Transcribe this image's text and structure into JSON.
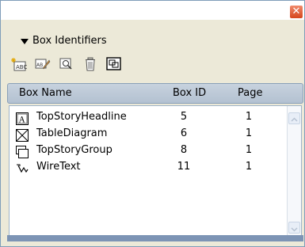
{
  "window": {
    "close_glyph": "✕"
  },
  "panel": {
    "title": "Box Identifiers"
  },
  "toolbar": {
    "buttons": [
      {
        "icon": "new-identifier-icon"
      },
      {
        "icon": "rename-identifier-icon"
      },
      {
        "icon": "find-box-icon"
      },
      {
        "icon": "delete-identifier-icon"
      },
      {
        "icon": "group-boxes-icon"
      }
    ]
  },
  "table": {
    "columns": [
      "Box Name",
      "Box ID",
      "Page"
    ],
    "rows": [
      {
        "name": "TopStoryHeadline",
        "box_id": "5",
        "page": "1",
        "icon": "text-box-icon"
      },
      {
        "name": "TableDiagram",
        "box_id": "6",
        "page": "1",
        "icon": "picture-box-icon"
      },
      {
        "name": "TopStoryGroup",
        "box_id": "8",
        "page": "1",
        "icon": "group-icon"
      },
      {
        "name": "WireText",
        "box_id": "11",
        "page": "1",
        "icon": "text-path-icon"
      }
    ]
  },
  "colors": {
    "header_bg": "#b3c1d1",
    "titlebar_close": "#d5461c",
    "bottom_bar": "#7d94b5"
  }
}
